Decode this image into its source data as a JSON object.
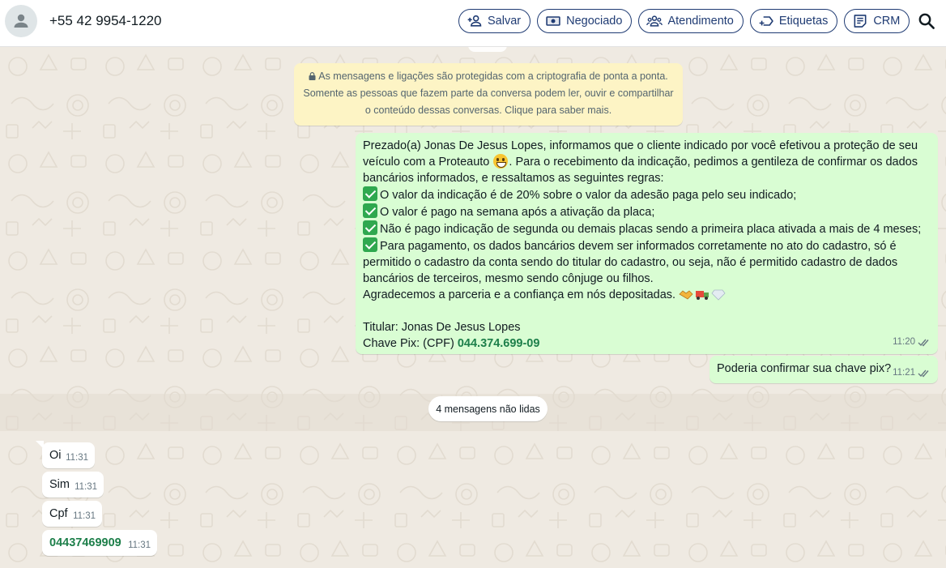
{
  "header": {
    "contact": "+55 42 9954-1220",
    "actions": [
      {
        "label": "Salvar"
      },
      {
        "label": "Negociado"
      },
      {
        "label": "Atendimento"
      },
      {
        "label": "Etiquetas"
      },
      {
        "label": "CRM"
      }
    ]
  },
  "encryption_notice": {
    "line1": "As mensagens e ligações são protegidas com a criptografia de ponta a ponta.",
    "line2": "Somente as pessoas que fazem parte da conversa podem ler, ouvir e compartilhar",
    "line3": "o conteúdo dessas conversas. Clique para saber mais."
  },
  "messages": {
    "long": {
      "p1a": "Prezado(a) Jonas De Jesus Lopes, informamos que o cliente indicado por você efetivou a proteção de seu veículo com a Proteauto",
      "p1b": ". Para o recebimento da indicação, pedimos a gentileza de confirmar os dados bancários informados, e  ressaltamos as seguintes regras:",
      "rule1": "O valor da indicação é de 20% sobre o valor da adesão paga pelo seu indicado;",
      "rule2": "O valor é pago na semana após a ativação da placa;",
      "rule3": "Não é pago indicação de segunda ou demais placas sendo a primeira placa ativada a mais de 4 meses;",
      "rule4": "Para pagamento, os dados bancários devem ser informados corretamente no ato do cadastro, só é permitido o cadastro da conta sendo do titular do cadastro, ou seja, não é permitido cadastro de dados bancários de terceiros, mesmo sendo cônjuge ou filhos.",
      "thanks": "Agradecemos a parceria e a confiança em nós depositadas.",
      "holder": "Titular: Jonas De Jesus Lopes",
      "pix_label": "Chave Pix: (CPF) ",
      "pix_value": "044.374.699-09",
      "time": "11:20"
    },
    "confirm": {
      "text": "Poderia confirmar sua chave pix?",
      "time": "11:21"
    }
  },
  "unread": {
    "label": "4 mensagens não lidas"
  },
  "incoming": [
    {
      "text": "Oi",
      "time": "11:31"
    },
    {
      "text": "Sim",
      "time": "11:31"
    },
    {
      "text": "Cpf",
      "time": "11:31"
    },
    {
      "text": "04437469909",
      "time": "11:31"
    }
  ],
  "colors": {
    "outgoing_bubble": "#d9fdd3",
    "incoming_bubble": "#ffffff",
    "chat_background": "#efeae2",
    "accent_navy": "#1f3b73",
    "link_green": "#1d7f4a"
  }
}
